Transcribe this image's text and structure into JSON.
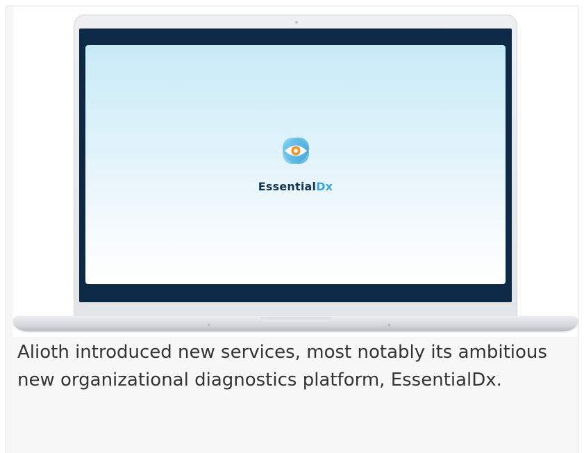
{
  "laptop_screen": {
    "logo_word_main": "Essential",
    "logo_word_accent": "Dx",
    "logo_icon": "eye-icon"
  },
  "caption": {
    "text": "Alioth introduced new services, most notably its ambitious new organizational diagnostics platform, EssentialDx."
  },
  "colors": {
    "navy": "#133656",
    "accent_blue": "#38a8dc",
    "eye_orange": "#f07a22",
    "bezel": "#0c2a45"
  }
}
